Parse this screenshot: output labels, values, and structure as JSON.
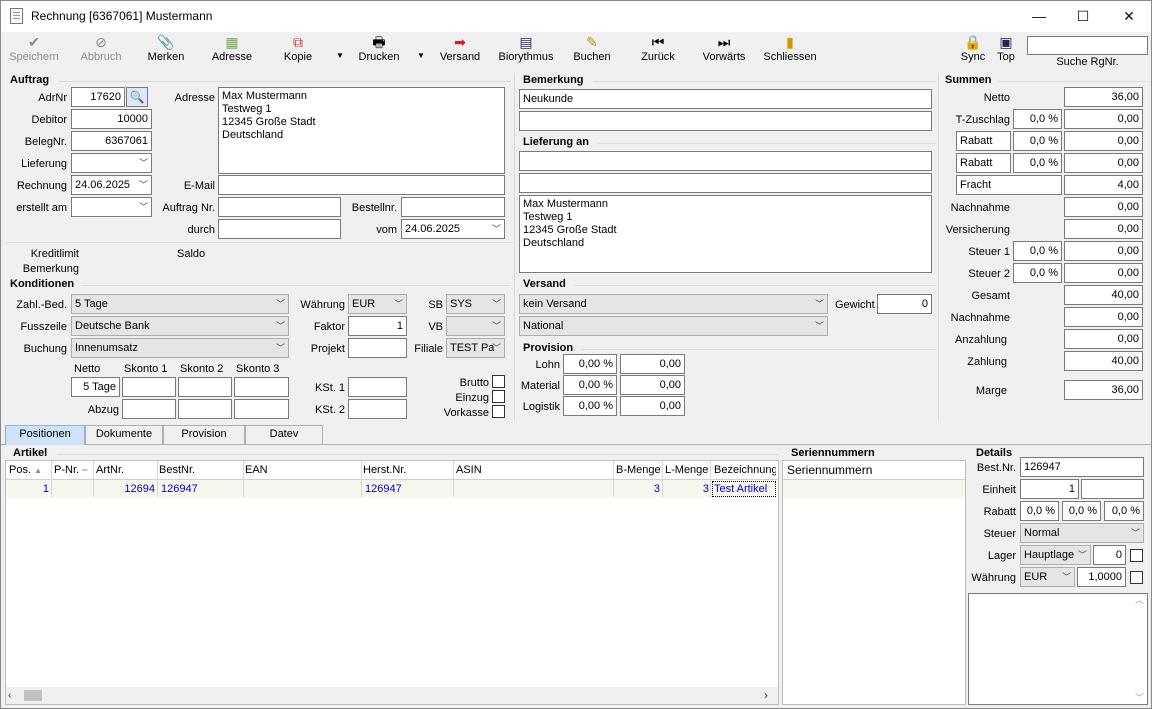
{
  "window": {
    "title": "Rechnung [6367061] Mustermann",
    "minimize": "—",
    "maximize": "☐",
    "close": "✕"
  },
  "toolbar": {
    "speichern": "Speichern",
    "abbruch": "Abbruch",
    "merken": "Merken",
    "adresse": "Adresse",
    "kopie": "Kopie",
    "drucken": "Drucken",
    "versand": "Versand",
    "biorythmus": "Biorythmus",
    "buchen": "Buchen",
    "zurueck": "Zurück",
    "vorwaerts": "Vorwärts",
    "schliessen": "Schliessen",
    "sync": "Sync",
    "top": "Top",
    "search_value": "",
    "search_label": "Suche RgNr."
  },
  "icons": {
    "speichern": "checkmark-icon",
    "abbruch": "cancel-icon",
    "merken": "paperclip-icon",
    "adresse": "address-card-icon",
    "kopie": "copy-icon",
    "drucken": "printer-icon",
    "versand": "send-icon",
    "biorythmus": "calendar-icon",
    "buchen": "book-icon",
    "zurueck": "previous-icon",
    "vorwaerts": "next-icon",
    "schliessen": "exit-door-icon",
    "sync": "lock-icon",
    "top": "window-icon"
  },
  "auftrag": {
    "header": "Auftrag",
    "adrnr_label": "AdrNr",
    "adrnr": "17620",
    "debitor_label": "Debitor",
    "debitor": "10000",
    "belegnr_label": "BelegNr.",
    "belegnr": "6367061",
    "lieferung_label": "Lieferung",
    "lieferung": "",
    "rechnung_label": "Rechnung",
    "rechnung": "24.06.2025",
    "erstellt_label": "erstellt am",
    "erstellt": "",
    "adresse_label": "Adresse",
    "adresse": "Max Mustermann\nTestweg 1\n12345 Große Stadt\nDeutschland",
    "email_label": "E-Mail",
    "email": "",
    "auftragnr_label": "Auftrag Nr.",
    "auftragnr": "",
    "bestellnr_label": "Bestellnr.",
    "bestellnr": "",
    "durch_label": "durch",
    "durch": "",
    "vom_label": "vom",
    "vom": "24.06.2025",
    "kreditlimit_label": "Kreditlimit",
    "saldo_label": "Saldo",
    "bemerkung_label": "Bemerkung"
  },
  "bemerkung": {
    "header": "Bemerkung",
    "line1": "Neukunde",
    "line2": ""
  },
  "lieferung_an": {
    "header": "Lieferung an",
    "line1": "",
    "line2": "",
    "address": "Max Mustermann\nTestweg 1\n12345 Große Stadt\nDeutschland"
  },
  "summen": {
    "header": "Summen",
    "netto_label": "Netto",
    "netto": "36,00",
    "tzuschlag_label": "T-Zuschlag",
    "tzuschlag_pct": "0,0 %",
    "tzuschlag": "0,00",
    "rabatt1_label": "Rabatt",
    "rabatt1_pct": "0,0 %",
    "rabatt1": "0,00",
    "rabatt2_label": "Rabatt",
    "rabatt2_pct": "0,0 %",
    "rabatt2": "0,00",
    "fracht_label": "Fracht",
    "fracht": "4,00",
    "nachnahme1_label": "Nachnahme",
    "nachnahme1": "0,00",
    "versicherung_label": "Versicherung",
    "versicherung": "0,00",
    "steuer1_label": "Steuer 1",
    "steuer1_pct": "0,0 %",
    "steuer1": "0,00",
    "steuer2_label": "Steuer 2",
    "steuer2_pct": "0,0 %",
    "steuer2": "0,00",
    "gesamt_label": "Gesamt",
    "gesamt": "40,00",
    "nachnahme2_label": "Nachnahme",
    "nachnahme2": "0,00",
    "anzahlung_label": "Anzahlung",
    "anzahlung": "0,00",
    "zahlung_label": "Zahlung",
    "zahlung": "40,00",
    "marge_label": "Marge",
    "marge": "36,00"
  },
  "konditionen": {
    "header": "Konditionen",
    "zahl_label": "Zahl.-Bed.",
    "zahl": "5 Tage",
    "fusszeile_label": "Fusszeile",
    "fusszeile": "Deutsche Bank",
    "buchung_label": "Buchung",
    "buchung": "Innenumsatz",
    "waehrung_label": "Währung",
    "waehrung": "EUR",
    "faktor_label": "Faktor",
    "faktor": "1",
    "projekt_label": "Projekt",
    "projekt": "",
    "sb_label": "SB",
    "sb": "SYS",
    "vb_label": "VB",
    "vb": "",
    "filiale_label": "Filiale",
    "filiale": "TEST Pa",
    "netto_label": "Netto",
    "skonto1_label": "Skonto 1",
    "skonto2_label": "Skonto 2",
    "skonto3_label": "Skonto 3",
    "netto_value": "5 Tage",
    "abzug_label": "Abzug",
    "kst1_label": "KSt. 1",
    "kst1": "",
    "kst2_label": "KSt. 2",
    "kst2": "",
    "brutto_label": "Brutto",
    "einzug_label": "Einzug",
    "vorkasse_label": "Vorkasse"
  },
  "versand": {
    "header": "Versand",
    "versandart": "kein Versand",
    "region": "National",
    "gewicht_label": "Gewicht",
    "gewicht": "0"
  },
  "provision": {
    "header": "Provision",
    "lohn_label": "Lohn",
    "lohn_pct": "0,00 %",
    "lohn": "0,00",
    "material_label": "Material",
    "material_pct": "0,00 %",
    "material": "0,00",
    "logistik_label": "Logistik",
    "logistik_pct": "0,00 %",
    "logistik": "0,00"
  },
  "tabs": [
    {
      "label": "Positionen"
    },
    {
      "label": "Dokumente"
    },
    {
      "label": "Provision"
    },
    {
      "label": "Datev"
    }
  ],
  "artikel": {
    "header": "Artikel",
    "columns": [
      "Pos.",
      "P-Nr.",
      "ArtNr.",
      "BestNr.",
      "EAN",
      "Herst.Nr.",
      "ASIN",
      "B-Menge",
      "L-Menge",
      "Bezeichnung"
    ],
    "rows": [
      {
        "pos": "1",
        "pnr": "",
        "artnr": "12694",
        "bestnr": "126947",
        "ean": "",
        "herstnr": "126947",
        "asin": "",
        "bmenge": "3",
        "lmenge": "3",
        "bezeichnung": "Test Artikel"
      }
    ]
  },
  "seriennummern": {
    "header": "Seriennummern",
    "column": "Seriennummern"
  },
  "details": {
    "header": "Details",
    "bestnr_label": "Best.Nr.",
    "bestnr": "126947",
    "einheit_label": "Einheit",
    "einheit": "1",
    "einheit2": "",
    "rabatt_label": "Rabatt",
    "rabatt1": "0,0 %",
    "rabatt2": "0,0 %",
    "rabatt3": "0,0 %",
    "steuer_label": "Steuer",
    "steuer": "Normal",
    "lager_label": "Lager",
    "lager": "Hauptlage",
    "lager_qty": "0",
    "waehrung_label": "Währung",
    "waehrung": "EUR",
    "kurs": "1,0000",
    "notes": ""
  }
}
